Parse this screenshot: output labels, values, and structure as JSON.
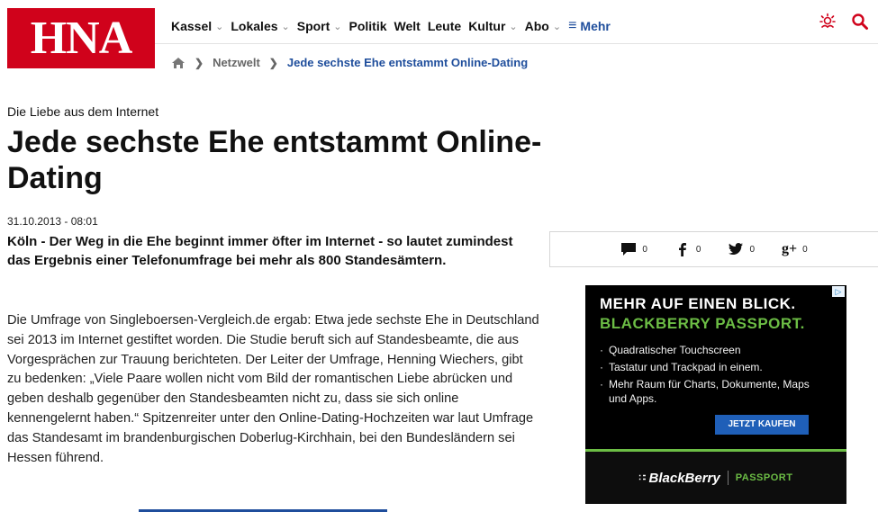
{
  "logo": {
    "text": "HNA",
    "color": "#d0021b"
  },
  "nav": {
    "items": [
      {
        "label": "Kassel",
        "has_dropdown": true
      },
      {
        "label": "Lokales",
        "has_dropdown": true
      },
      {
        "label": "Sport",
        "has_dropdown": true
      },
      {
        "label": "Politik",
        "has_dropdown": false
      },
      {
        "label": "Welt",
        "has_dropdown": false
      },
      {
        "label": "Leute",
        "has_dropdown": false
      },
      {
        "label": "Kultur",
        "has_dropdown": true
      },
      {
        "label": "Abo",
        "has_dropdown": true
      }
    ],
    "more_label": "Mehr",
    "icons": [
      "weather-icon",
      "search-icon"
    ]
  },
  "breadcrumb": {
    "home_icon": "home-icon",
    "section": "Netzwelt",
    "current": "Jede sechste Ehe entstammt Online-Dating"
  },
  "article": {
    "kicker": "Die Liebe aus dem Internet",
    "headline": "Jede sechste Ehe entstammt Online-Dating",
    "date": "31.10.2013 - 08:01",
    "lead": "Köln - Der Weg in die Ehe beginnt immer öfter im Internet - so lautet zumindest das Ergebnis einer Telefonumfrage bei mehr als 800 Standesämtern.",
    "body": "Die Umfrage von Singleboersen-Vergleich.de ergab: Etwa jede sechste Ehe in Deutschland sei 2013 im Internet gestiftet worden. Die Studie beruft sich auf Standesbeamte, die aus Vorgesprächen zur Trauung berichteten. Der Leiter der Umfrage, Henning Wiechers, gibt zu bedenken: „Viele Paare wollen nicht vom Bild der romantischen Liebe abrücken und geben deshalb gegenüber den Standesbeamten nicht zu, dass sie sich online kennengelernt haben.“ Spitzenreiter unter den Online-Dating-Hochzeiten war laut Umfrage das Standesamt im brandenburgischen Doberlug-Kirchhain, bei den Bundesländern sei Hessen führend."
  },
  "social": {
    "comments": {
      "icon": "comment-icon",
      "count": "0"
    },
    "facebook": {
      "icon": "facebook-icon",
      "count": "0"
    },
    "twitter": {
      "icon": "twitter-icon",
      "count": "0"
    },
    "googleplus": {
      "icon": "googleplus-icon",
      "label": "g+",
      "count": "0"
    }
  },
  "ad": {
    "headline1": "MEHR AUF EINEN BLICK.",
    "headline2": "BLACKBERRY PASSPORT.",
    "bullets": [
      "Quadratischer Touchscreen",
      "Tastatur und Trackpad in einem.",
      "Mehr Raum für Charts, Dokumente, Maps und Apps."
    ],
    "cta": "JETZT KAUFEN",
    "brand": "BlackBerry",
    "product": "PASSPORT",
    "accent_color": "#6cbd45",
    "cta_color": "#1f5fb8"
  }
}
